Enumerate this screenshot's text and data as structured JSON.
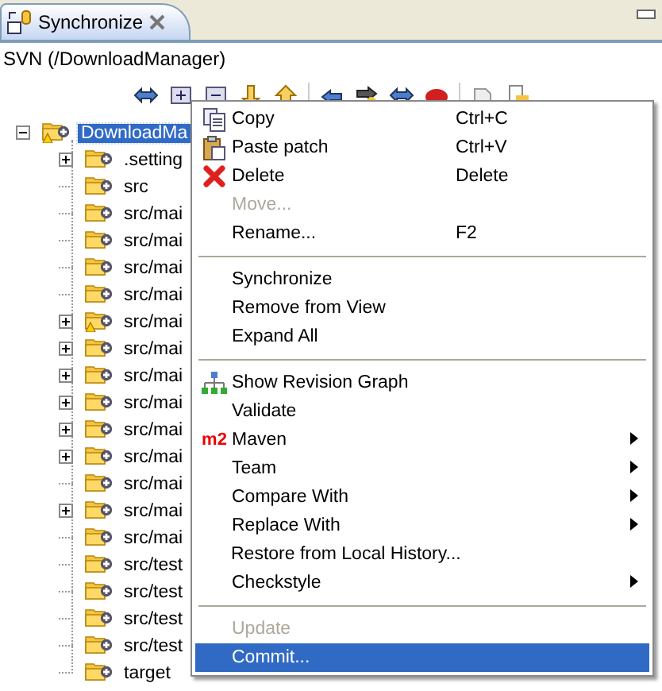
{
  "tab": {
    "title": "Synchronize",
    "selected": true
  },
  "view_label": "SVN (/DownloadManager)",
  "tree": [
    {
      "label": "DownloadMa",
      "expanded": true,
      "selected": true,
      "warning": true,
      "children": [
        {
          "label": ".setting",
          "expandable": true,
          "warning": false,
          "selected": false
        },
        {
          "label": "src",
          "expandable": false,
          "warning": false,
          "selected": false
        },
        {
          "label": "src/mai",
          "expandable": false,
          "warning": false,
          "selected": false
        },
        {
          "label": "src/mai",
          "expandable": false,
          "warning": false,
          "selected": false
        },
        {
          "label": "src/mai",
          "expandable": false,
          "warning": false,
          "selected": false
        },
        {
          "label": "src/mai",
          "expandable": false,
          "warning": false,
          "selected": false
        },
        {
          "label": "src/mai",
          "expandable": true,
          "warning": true,
          "selected": false
        },
        {
          "label": "src/mai",
          "expandable": true,
          "warning": false,
          "selected": false
        },
        {
          "label": "src/mai",
          "expandable": true,
          "warning": false,
          "selected": false
        },
        {
          "label": "src/mai",
          "expandable": true,
          "warning": false,
          "selected": false
        },
        {
          "label": "src/mai",
          "expandable": true,
          "warning": false,
          "selected": false
        },
        {
          "label": "src/mai",
          "expandable": true,
          "warning": false,
          "selected": false
        },
        {
          "label": "src/mai",
          "expandable": false,
          "warning": false,
          "selected": false
        },
        {
          "label": "src/mai",
          "expandable": true,
          "warning": false,
          "selected": false
        },
        {
          "label": "src/mai",
          "expandable": false,
          "warning": false,
          "selected": false
        },
        {
          "label": "src/test",
          "expandable": false,
          "warning": false,
          "selected": false
        },
        {
          "label": "src/test",
          "expandable": false,
          "warning": false,
          "selected": false
        },
        {
          "label": "src/test",
          "expandable": false,
          "warning": false,
          "selected": false
        },
        {
          "label": "src/test",
          "expandable": false,
          "warning": false,
          "selected": false
        },
        {
          "label": "target",
          "expandable": false,
          "warning": false,
          "selected": false
        }
      ]
    }
  ],
  "context_menu": {
    "sections": [
      [
        {
          "label": "Copy",
          "kind": "copy",
          "shortcut": "Ctrl+C",
          "disabled": false,
          "submenu": false,
          "selected": false
        },
        {
          "label": "Paste patch",
          "kind": "paste",
          "shortcut": "Ctrl+V",
          "disabled": false,
          "submenu": false,
          "selected": false
        },
        {
          "label": "Delete",
          "kind": "delete",
          "shortcut": "Delete",
          "disabled": false,
          "submenu": false,
          "selected": false
        },
        {
          "label": "Move...",
          "disabled": true,
          "submenu": false,
          "selected": false
        },
        {
          "label": "Rename...",
          "shortcut": "F2",
          "disabled": false,
          "submenu": false,
          "selected": false
        }
      ],
      [
        {
          "label": "Synchronize",
          "disabled": false,
          "submenu": false,
          "selected": false
        },
        {
          "label": "Remove from View",
          "disabled": false,
          "submenu": false,
          "selected": false
        },
        {
          "label": "Expand All",
          "disabled": false,
          "submenu": false,
          "selected": false
        }
      ],
      [
        {
          "label": "Show Revision Graph",
          "kind": "graph",
          "disabled": false,
          "submenu": false,
          "selected": false
        },
        {
          "label": "Validate",
          "disabled": false,
          "submenu": false,
          "selected": false
        },
        {
          "label": "Maven",
          "kind": "maven",
          "icon_text": "m2",
          "disabled": false,
          "submenu": true,
          "selected": false
        },
        {
          "label": "Team",
          "disabled": false,
          "submenu": true,
          "selected": false
        },
        {
          "label": "Compare With",
          "disabled": false,
          "submenu": true,
          "selected": false
        },
        {
          "label": "Replace With",
          "disabled": false,
          "submenu": true,
          "selected": false
        },
        {
          "label": "Restore from Local History...",
          "disabled": false,
          "submenu": false,
          "selected": false
        },
        {
          "label": "Checkstyle",
          "disabled": false,
          "submenu": true,
          "selected": false
        }
      ],
      [
        {
          "label": "Update",
          "disabled": true,
          "submenu": false,
          "selected": false
        },
        {
          "label": "Commit...",
          "disabled": false,
          "submenu": false,
          "selected": true
        }
      ]
    ]
  }
}
